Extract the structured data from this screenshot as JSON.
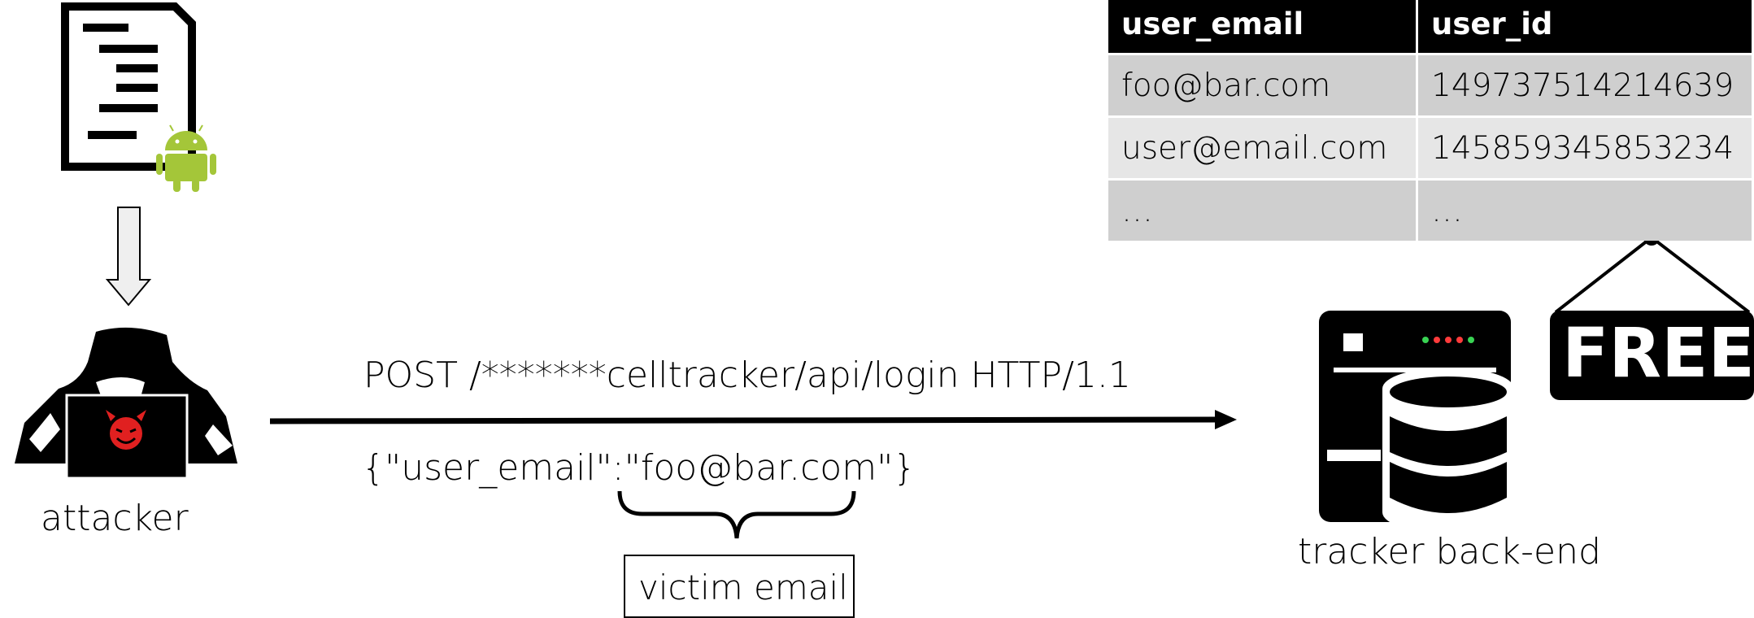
{
  "request": {
    "line": "POST /*******celltracker/api/login HTTP/1.1",
    "body": "{\"user_email\":\"foo@bar.com\"}"
  },
  "labels": {
    "attacker": "attacker",
    "tracker": "tracker back-end",
    "victim_email": "victim email",
    "free_sign": "FREE"
  },
  "table": {
    "headers": [
      "user_email",
      "user_id"
    ],
    "rows": [
      [
        "foo@bar.com",
        "149737514214639"
      ],
      [
        "user@email.com",
        "145859345853234"
      ],
      [
        "…",
        "…"
      ]
    ]
  },
  "icons": [
    "document-icon",
    "android-icon",
    "down-arrow-icon",
    "hacker-icon",
    "devil-icon",
    "server-icon",
    "database-icon",
    "free-sign-icon"
  ],
  "colors": {
    "android": "#a4c639",
    "devil": "#e02020",
    "led_green": "#39d353",
    "led_red": "#ff3b3b",
    "table_dark": "#cfcfcf",
    "table_light": "#e6e6e6"
  }
}
